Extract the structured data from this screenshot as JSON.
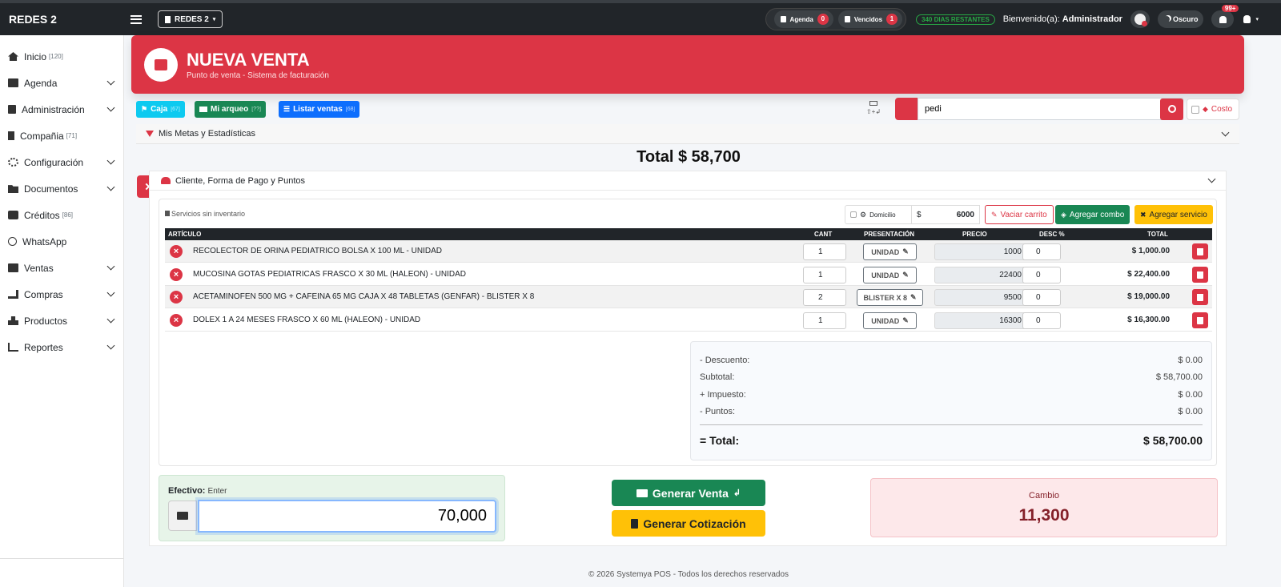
{
  "topbar": {
    "brand": "REDES 2",
    "company": "REDES 2",
    "agenda_label": "Agenda",
    "agenda_count": "0",
    "vencidos_label": "Vencidos",
    "vencidos_count": "1",
    "days_remaining": "340 DIAS RESTANTES",
    "welcome_prefix": "Bienvenido(a):",
    "welcome_user": "Administrador",
    "theme_label": "Oscuro",
    "notif_count": "99+"
  },
  "sidebar": {
    "items": [
      {
        "label": "Inicio",
        "count": "[120]"
      },
      {
        "label": "Agenda",
        "count": ""
      },
      {
        "label": "Administración",
        "count": ""
      },
      {
        "label": "Compañia",
        "count": "[71]"
      },
      {
        "label": "Configuración",
        "count": ""
      },
      {
        "label": "Documentos",
        "count": ""
      },
      {
        "label": "Créditos",
        "count": "[86]"
      },
      {
        "label": "WhatsApp",
        "count": ""
      },
      {
        "label": "Ventas",
        "count": ""
      },
      {
        "label": "Compras",
        "count": ""
      },
      {
        "label": "Productos",
        "count": ""
      },
      {
        "label": "Reportes",
        "count": ""
      }
    ]
  },
  "header": {
    "title": "NUEVA VENTA",
    "subtitle": "Punto de venta - Sistema de facturación"
  },
  "toolbar": {
    "caja": "Caja",
    "caja_meta": "[67]",
    "arqueo": "Mi arqueo",
    "arqueo_meta": "[??]",
    "listar": "Listar ventas",
    "listar_meta": "[68]",
    "search_value": "pedi",
    "costo_label": "Costo",
    "kbd_hint": "⇧+↲"
  },
  "metas_label": "Mis Metas y Estadísticas",
  "total_label": "Total $ 58,700",
  "cliente_label": "Cliente, Forma de Pago y Puntos",
  "cart": {
    "sin_inventario": "Servicios sin inventario",
    "domicilio_label": "Domicilio",
    "domicilio_currency": "$",
    "domicilio_value": "6000",
    "vaciar": "Vaciar carrito",
    "agregar_combo": "Agregar combo",
    "agregar_servicio": "Agregar servicio",
    "columns": [
      "ARTÍCULO",
      "CANT",
      "PRESENTACIÓN",
      "PRECIO",
      "DESC %",
      "TOTAL"
    ],
    "rows": [
      {
        "articulo": "RECOLECTOR DE ORINA PEDIATRICO BOLSA X 100 ML - UNIDAD",
        "cant": "1",
        "presentacion": "UNIDAD",
        "precio": "1000",
        "desc": "0",
        "total": "$ 1,000.00"
      },
      {
        "articulo": "MUCOSINA GOTAS PEDIATRICAS FRASCO X 30 ML (HALEON) - UNIDAD",
        "cant": "1",
        "presentacion": "UNIDAD",
        "precio": "22400",
        "desc": "0",
        "total": "$ 22,400.00"
      },
      {
        "articulo": "ACETAMINOFEN 500 MG + CAFEINA 65 MG CAJA X 48 TABLETAS (GENFAR) - BLISTER X 8",
        "cant": "2",
        "presentacion": "BLISTER X 8",
        "precio": "9500",
        "desc": "0",
        "total": "$ 19,000.00"
      },
      {
        "articulo": "DOLEX 1 A 24 MESES FRASCO X 60 ML (HALEON) - UNIDAD",
        "cant": "1",
        "presentacion": "UNIDAD",
        "precio": "16300",
        "desc": "0",
        "total": "$ 16,300.00"
      }
    ]
  },
  "summary": {
    "descuento_label": "- Descuento:",
    "descuento": "$ 0.00",
    "subtotal_label": "Subtotal:",
    "subtotal": "$ 58,700.00",
    "impuesto_label": "+ Impuesto:",
    "impuesto": "$ 0.00",
    "puntos_label": "- Puntos:",
    "puntos": "$ 0.00",
    "total_label": "= Total:",
    "total": "$ 58,700.00"
  },
  "payment": {
    "efectivo_label": "Efectivo:",
    "efectivo_hint": "Enter",
    "efectivo_value": "70,000",
    "generar_venta": "Generar Venta",
    "generar_cotizacion": "Generar Cotización",
    "cambio_label": "Cambio",
    "cambio_value": "11,300"
  },
  "footer": "© 2026 Systemya POS - Todos los derechos reservados",
  "colors": {
    "primary_red": "#dc3545",
    "success": "#198754",
    "info": "#0dcaf0",
    "blue": "#0d6efd",
    "warning": "#ffc107",
    "dark": "#212529"
  }
}
